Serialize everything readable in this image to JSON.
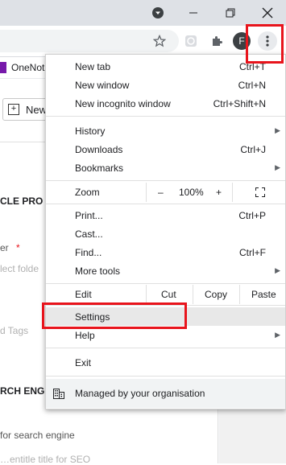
{
  "bookmark": {
    "label": "OneNot"
  },
  "page": {
    "new_button": "New",
    "section1": "CLE PRO",
    "field1_label": "er",
    "required_mark": "*",
    "field1_placeholder": "lect folde",
    "tags_label": "d Tags",
    "section2": "RCH ENG",
    "field2_label": "for search engine",
    "field2_placeholder": "…entitle title for SEO"
  },
  "menu": {
    "new_tab": "New tab",
    "new_tab_sc": "Ctrl+T",
    "new_window": "New window",
    "new_window_sc": "Ctrl+N",
    "incognito": "New incognito window",
    "incognito_sc": "Ctrl+Shift+N",
    "history": "History",
    "downloads": "Downloads",
    "downloads_sc": "Ctrl+J",
    "bookmarks": "Bookmarks",
    "zoom": "Zoom",
    "zoom_minus": "–",
    "zoom_value": "100%",
    "zoom_plus": "+",
    "print": "Print...",
    "print_sc": "Ctrl+P",
    "cast": "Cast...",
    "find": "Find...",
    "find_sc": "Ctrl+F",
    "more_tools": "More tools",
    "edit": "Edit",
    "cut": "Cut",
    "copy": "Copy",
    "paste": "Paste",
    "settings": "Settings",
    "help": "Help",
    "exit": "Exit",
    "managed": "Managed by your organisation"
  },
  "profile_initial": "F",
  "colors": {
    "highlight": "#e8141c",
    "onenote": "#7719aa"
  }
}
